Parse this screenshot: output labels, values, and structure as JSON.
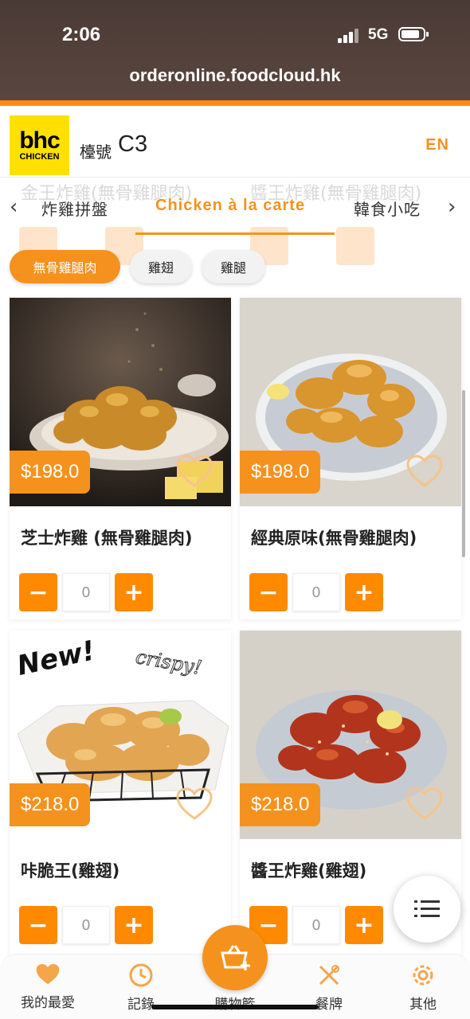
{
  "status_bar": {
    "time": "2:06",
    "network": "5G"
  },
  "browser": {
    "url": "orderonline.foodcloud.hk"
  },
  "header": {
    "logo_main": "bhc",
    "logo_sub": "CHICKEN",
    "table_label": "檯號",
    "table_number": "C3",
    "language": "EN"
  },
  "ghost_row": {
    "left": "金王炸雞(無骨雞腿肉)",
    "right": "醬王炸雞(無骨雞腿肉)"
  },
  "tabs": [
    {
      "label": "炸雞拼盤"
    },
    {
      "label": "Chicken à la carte"
    },
    {
      "label": "韓食小吃"
    }
  ],
  "chips": [
    {
      "label": "無骨雞腿肉"
    },
    {
      "label": "雞翅"
    },
    {
      "label": "雞腿"
    }
  ],
  "products": [
    {
      "name": "芝士炸雞 (無骨雞腿肉)",
      "price": "$198.0",
      "qty": "0"
    },
    {
      "name": "經典原味(無骨雞腿肉)",
      "price": "$198.0",
      "qty": "0"
    },
    {
      "name": "咔脆王(雞翅)",
      "price": "$218.0",
      "qty": "0",
      "badge_new": "New!",
      "badge_crispy": "crispy!"
    },
    {
      "name": "醬王炸雞(雞翅)",
      "price": "$218.0",
      "qty": "0"
    }
  ],
  "bottom_nav": [
    {
      "label": "我的最愛",
      "icon": "heart-icon"
    },
    {
      "label": "記錄",
      "icon": "clock-icon"
    },
    {
      "label": "購物籃",
      "icon": "basket-icon"
    },
    {
      "label": "餐牌",
      "icon": "utensils-icon"
    },
    {
      "label": "其他",
      "icon": "gear-icon"
    }
  ],
  "colors": {
    "accent": "#f5921e",
    "qty_button": "#ff8a00",
    "logo_yellow": "#ffe000"
  }
}
